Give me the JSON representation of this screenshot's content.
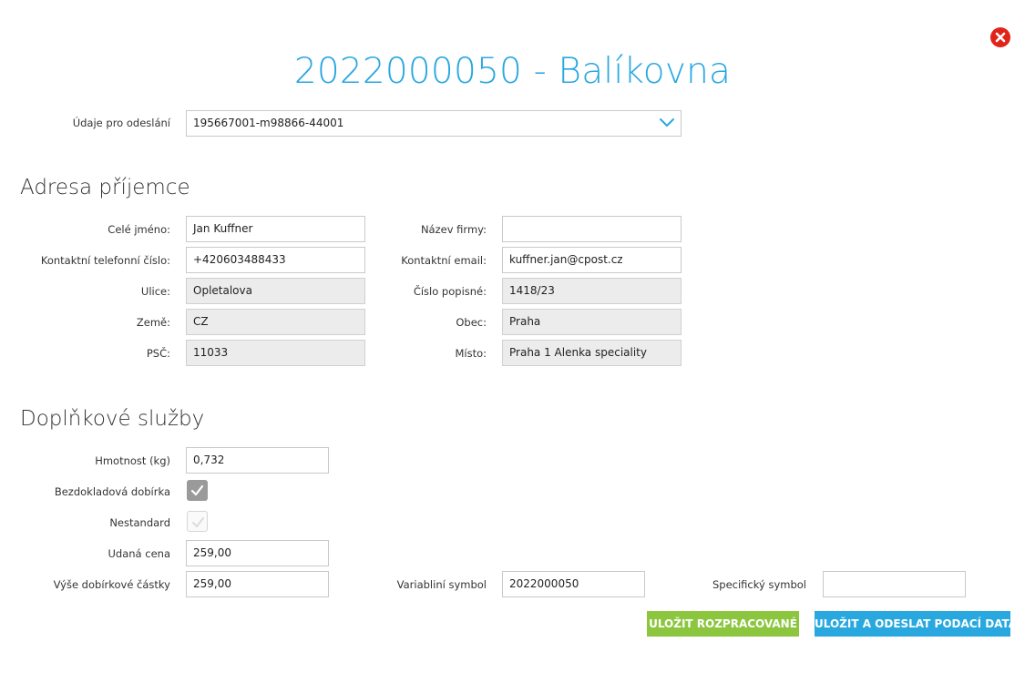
{
  "dialog": {
    "title": "2022000050 - Balíkovna",
    "close_icon": "close-circle-icon",
    "close_color": "#e2231a",
    "accent_color": "#29a8e0"
  },
  "sender": {
    "label": "Údaje pro odeslání",
    "value": "195667001-m98866-44001",
    "dropdown_icon": "chevron-down-icon"
  },
  "recipient": {
    "heading": "Adresa příjemce",
    "full_name": {
      "label": "Celé jméno:",
      "value": "Jan Kuffner"
    },
    "company": {
      "label": "Název firmy:",
      "value": ""
    },
    "phone": {
      "label": "Kontaktní telefonní číslo:",
      "value": "+420603488433"
    },
    "email": {
      "label": "Kontaktní email:",
      "value": "kuffner.jan@cpost.cz"
    },
    "street": {
      "label": "Ulice:",
      "value": "Opletalova"
    },
    "house_number": {
      "label": "Číslo popisné:",
      "value": "1418/23"
    },
    "country": {
      "label": "Země:",
      "value": "CZ"
    },
    "city": {
      "label": "Obec:",
      "value": "Praha"
    },
    "zip": {
      "label": "PSČ:",
      "value": "11033"
    },
    "place": {
      "label": "Místo:",
      "value": "Praha 1 Alenka speciality"
    }
  },
  "services": {
    "heading": "Doplňkové služby",
    "weight": {
      "label": "Hmotnost (kg)",
      "value": "0,732"
    },
    "cod_paperless": {
      "label": "Bezdokladová dobírka",
      "checked": true
    },
    "non_standard": {
      "label": "Nestandard",
      "checked": false
    },
    "declared_value": {
      "label": "Udaná cena",
      "value": "259,00"
    },
    "cod_amount": {
      "label": "Výše dobírkové částky",
      "value": "259,00"
    },
    "variable_symbol": {
      "label": "Variabliní symbol",
      "value": "2022000050"
    },
    "specific_symbol": {
      "label": "Specifický symbol",
      "value": ""
    }
  },
  "actions": {
    "save_draft": "ULOŽIT ROZPRACOVANÉ",
    "save_send": "ULOŽIT A ODESLAT PODACÍ DATA",
    "save_draft_color": "#8cc63f",
    "save_send_color": "#29a8e0"
  }
}
